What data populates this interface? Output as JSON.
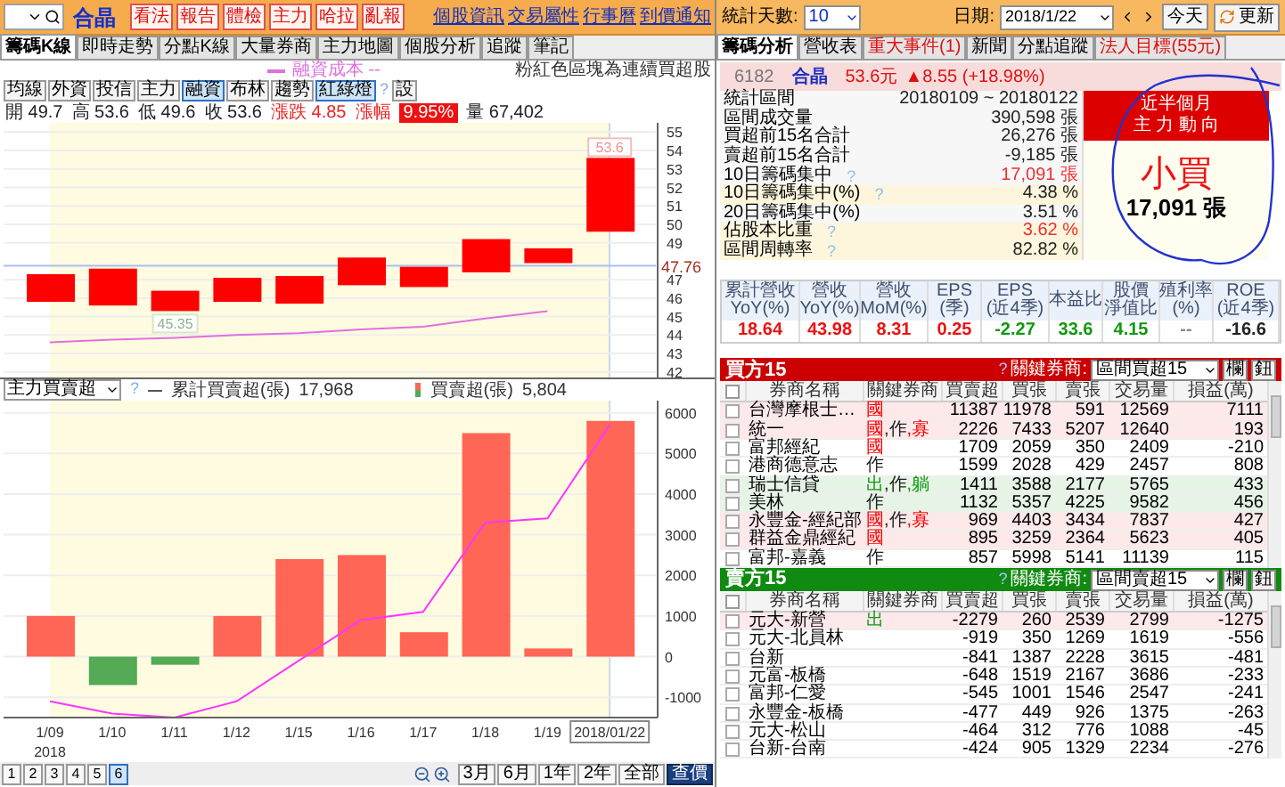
{
  "toolbar": {
    "stock_name": "合晶",
    "buttons": [
      "看法",
      "報告",
      "體檢",
      "主力",
      "哈拉",
      "亂報"
    ],
    "links": [
      "個股資訊",
      "交易屬性",
      "行事曆",
      "到價通知"
    ]
  },
  "right_toolbar": {
    "days_label": "統計天數:",
    "days_value": "10",
    "date_label": "日期:",
    "date_value": "2018/1/22",
    "today_button": "今天",
    "refresh_button": "更新"
  },
  "left_tabs": [
    {
      "label": "籌碼K線",
      "selected": true
    },
    {
      "label": "即時走勢",
      "selected": false
    },
    {
      "label": "分點K線",
      "selected": false
    },
    {
      "label": "大量券商",
      "selected": false
    },
    {
      "label": "主力地圖",
      "selected": false
    },
    {
      "label": "個股分析",
      "selected": false
    },
    {
      "label": "追蹤",
      "selected": false
    },
    {
      "label": "筆記",
      "selected": false
    }
  ],
  "left_note": "粉紅色區塊為連續買超股",
  "right_tabs": [
    {
      "label": "籌碼分析",
      "selected": true,
      "alert": false
    },
    {
      "label": "營收表",
      "selected": false,
      "alert": false
    },
    {
      "label": "重大事件(1)",
      "selected": false,
      "alert": true
    },
    {
      "label": "新聞",
      "selected": false,
      "alert": false
    },
    {
      "label": "分點追蹤",
      "selected": false,
      "alert": false
    },
    {
      "label": "法人目標(55元)",
      "selected": false,
      "alert": true
    }
  ],
  "price_chart": {
    "legend": "融資成本 --",
    "indicators": [
      {
        "label": "均線",
        "selected": false
      },
      {
        "label": "外資",
        "selected": false
      },
      {
        "label": "投信",
        "selected": false
      },
      {
        "label": "主力",
        "selected": false
      },
      {
        "label": "融資",
        "selected": true
      },
      {
        "label": "布林",
        "selected": false
      },
      {
        "label": "趨勢",
        "selected": false
      },
      {
        "label": "紅綠燈",
        "selected": true
      }
    ],
    "help": "?",
    "settings_button": "設",
    "quote": [
      {
        "text": "開 49.7",
        "kind": "plain"
      },
      {
        "text": "高 53.6",
        "kind": "plain"
      },
      {
        "text": "低 49.6",
        "kind": "plain"
      },
      {
        "text": "收 53.6",
        "kind": "plain"
      },
      {
        "text": "漲跌 4.85",
        "kind": "up"
      },
      {
        "text": "漲幅",
        "kind": "up"
      },
      {
        "text": "9.95%",
        "kind": "boxed"
      },
      {
        "text": "量 67,402",
        "kind": "plain"
      }
    ],
    "high_label": "53.6",
    "low_label": "45.35",
    "ref_label": "47.76",
    "y_axis_labels": [
      "55",
      "54",
      "53",
      "52",
      "51",
      "50",
      "49",
      "47",
      "46",
      "45",
      "44",
      "43",
      "42"
    ]
  },
  "flow_chart": {
    "indicator_select": "主力買賣超",
    "help": "?",
    "legend_line_value": "17,968",
    "legend_bar_value": "5,804",
    "year_label": "2018",
    "chart_data": {
      "type": "bar",
      "stacked": true,
      "grid": true,
      "bands": [
        {
          "axis": "x",
          "from": "1/09",
          "to": "2018/01/22",
          "color": "#fffbe0"
        }
      ],
      "ref_lines": [
        {
          "axis": "x",
          "value": "2018/01/22",
          "color": "#c8d8f0"
        }
      ],
      "categories": [
        "1/09",
        "1/10",
        "1/11",
        "1/12",
        "1/15",
        "1/16",
        "1/17",
        "1/18",
        "1/19",
        "2018/01/22"
      ],
      "ylim": [
        -1500,
        6300
      ],
      "yticks": [
        -1000,
        0,
        1000,
        2000,
        3000,
        4000,
        5000,
        6000
      ],
      "series": [
        {
          "name": "買賣超(張)",
          "color": "#ff6655",
          "values": [
            1000,
            null,
            null,
            1000,
            2400,
            2500,
            600,
            5500,
            200,
            5800
          ]
        },
        {
          "color": "#55aa55",
          "values": [
            null,
            -700,
            -200,
            null,
            null,
            null,
            null,
            null,
            null,
            null
          ]
        },
        {
          "name": "累計買賣超(張)",
          "type": "line",
          "color": "#ff33ff",
          "values": [
            -1100,
            -1400,
            -1500,
            -1100,
            -100,
            900,
            1100,
            3300,
            3400,
            5700
          ]
        }
      ]
    }
  },
  "bottom_nav": {
    "pages": [
      {
        "label": "1",
        "selected": false
      },
      {
        "label": "2",
        "selected": false
      },
      {
        "label": "3",
        "selected": false
      },
      {
        "label": "4",
        "selected": false
      },
      {
        "label": "5",
        "selected": false
      },
      {
        "label": "6",
        "selected": true
      }
    ],
    "ranges": [
      {
        "label": "3月",
        "selected": false
      },
      {
        "label": "6月",
        "selected": false
      },
      {
        "label": "1年",
        "selected": false
      },
      {
        "label": "2年",
        "selected": false
      },
      {
        "label": "全部",
        "selected": false
      },
      {
        "label": "查價",
        "selected": true
      }
    ]
  },
  "stock_header": {
    "code": "6182",
    "name": "合晶",
    "price": "53.6元",
    "change": "▲8.55 (+18.98%)"
  },
  "stats": [
    {
      "label": "統計區間",
      "value": "20180109 ~ 20180122",
      "red": false,
      "shaded": false
    },
    {
      "label": "區間成交量",
      "value": "390,598 張",
      "red": false,
      "shaded": false
    },
    {
      "label": "買超前15名合計",
      "value": "26,276 張",
      "red": false,
      "shaded": false
    },
    {
      "label": "賣超前15名合計",
      "value": "-9,185 張",
      "red": false,
      "shaded": false
    },
    {
      "label": "10日籌碼集中",
      "help": "?",
      "value": "17,091 張",
      "red": true,
      "shaded": false
    },
    {
      "label": "10日籌碼集中(%)",
      "help": "?",
      "value": "4.38 %",
      "red": false,
      "shaded": true
    },
    {
      "label": "20日籌碼集中(%)",
      "value": "3.51 %",
      "red": false,
      "shaded": false
    },
    {
      "label": "佔股本比重",
      "help": "?",
      "value": "3.62 %",
      "red": true,
      "shaded": true
    },
    {
      "label": "區間周轉率",
      "help": "?",
      "value": "82.82 %",
      "red": false,
      "shaded": true
    }
  ],
  "trend_box": {
    "title": "近半個月",
    "subtitle": "主 力 動 向",
    "verdict": "小買",
    "amount": "17,091 張"
  },
  "fundamentals": [
    {
      "label": "累計營收",
      "sub": "YoY(%)",
      "value": "18.64",
      "color": "#ee1111"
    },
    {
      "label": "營收",
      "sub": "YoY(%)",
      "value": "43.98",
      "color": "#ee1111"
    },
    {
      "label": "營收",
      "sub": "MoM(%)",
      "value": "8.31",
      "color": "#ee1111"
    },
    {
      "label": "EPS",
      "sub": "(季)",
      "value": "0.25",
      "color": "#ee1111"
    },
    {
      "label": "EPS",
      "sub": "(近4季)",
      "value": "-2.27",
      "color": "#119911"
    },
    {
      "label": "本益比",
      "value": "33.6",
      "color": "#119911"
    },
    {
      "label": "股價",
      "sub": "淨值比",
      "value": "4.15",
      "color": "#119911"
    },
    {
      "label": "殖利率",
      "sub": "(%)",
      "value": "--",
      "color": "#888888"
    },
    {
      "label": "ROE",
      "sub": "(近4季)",
      "value": "-16.6",
      "color": "#222222"
    }
  ],
  "buy_table": {
    "title": "買方15",
    "help": "?",
    "filter_label": "關鍵券商:",
    "filter_value": "區間買超15",
    "buttons": [
      "欄",
      "鈕"
    ],
    "header_checked": false,
    "columns": [
      "券商名稱",
      "關鍵券商",
      "買賣超",
      "買張",
      "賣張",
      "交易量",
      "損益(萬)"
    ],
    "rows": [
      {
        "checked": false,
        "color": "#fde8ea",
        "tags": [
          {
            "color": "#ff0000"
          }
        ],
        "cells": [
          "台灣摩根士…",
          "國",
          "11387",
          "11978",
          "591",
          "12569",
          "7111"
        ]
      },
      {
        "checked": false,
        "color": "#fde8ea",
        "tags": [
          {
            "color": "#ff0000"
          },
          {
            "color": "#222222"
          },
          {
            "color": "#ff0000"
          }
        ],
        "cells": [
          "統一",
          "國,作,寡",
          "2226",
          "7433",
          "5207",
          "12640",
          "193"
        ]
      },
      {
        "checked": false,
        "color": "#ffffff",
        "tags": [
          {
            "color": "#ff0000"
          }
        ],
        "cells": [
          "富邦經紀",
          "國",
          "1709",
          "2059",
          "350",
          "2409",
          "-210"
        ]
      },
      {
        "checked": false,
        "color": "#ffffff",
        "tags": [
          {
            "color": "#222222"
          }
        ],
        "cells": [
          "港商德意志",
          "作",
          "1599",
          "2028",
          "429",
          "2457",
          "808"
        ]
      },
      {
        "checked": false,
        "color": "#e6f4e6",
        "tags": [
          {
            "color": "#119911"
          },
          {
            "color": "#222222"
          },
          {
            "color": "#119911"
          }
        ],
        "cells": [
          "瑞士信貸",
          "出,作,躺",
          "1411",
          "3588",
          "2177",
          "5765",
          "433"
        ]
      },
      {
        "checked": false,
        "color": "#e6f4e6",
        "tags": [
          {
            "color": "#222222"
          }
        ],
        "cells": [
          "美林",
          "作",
          "1132",
          "5357",
          "4225",
          "9582",
          "456"
        ]
      },
      {
        "checked": false,
        "color": "#fde8ea",
        "tags": [
          {
            "color": "#ff0000"
          },
          {
            "color": "#222222"
          },
          {
            "color": "#ff0000"
          }
        ],
        "cells": [
          "永豐金-經紀部",
          "國,作,寡",
          "969",
          "4403",
          "3434",
          "7837",
          "427"
        ]
      },
      {
        "checked": false,
        "color": "#fde8ea",
        "tags": [
          {
            "color": "#ff0000"
          }
        ],
        "cells": [
          "群益金鼎經紀",
          "國",
          "895",
          "3259",
          "2364",
          "5623",
          "405"
        ]
      },
      {
        "checked": false,
        "color": "#ffffff",
        "tags": [
          {
            "color": "#222222"
          }
        ],
        "cells": [
          "富邦-嘉義",
          "作",
          "857",
          "5998",
          "5141",
          "11139",
          "115"
        ]
      }
    ]
  },
  "sell_table": {
    "title": "賣方15",
    "help": "?",
    "filter_label": "關鍵券商:",
    "filter_value": "區間賣超15",
    "buttons": [
      "欄",
      "鈕"
    ],
    "header_checked": false,
    "columns": [
      "券商名稱",
      "關鍵券商",
      "買賣超",
      "買張",
      "賣張",
      "交易量",
      "損益(萬)"
    ],
    "rows": [
      {
        "checked": false,
        "color": "#fde8ea",
        "tags": [
          {
            "color": "#119911"
          }
        ],
        "cells": [
          "元大-新營",
          "出",
          "-2279",
          "260",
          "2539",
          "2799",
          "-1275"
        ]
      },
      {
        "checked": false,
        "color": "#ffffff",
        "cells": [
          "元大-北員林",
          "",
          "-919",
          "350",
          "1269",
          "1619",
          "-556"
        ]
      },
      {
        "checked": false,
        "color": "#ffffff",
        "cells": [
          "台新",
          "",
          "-841",
          "1387",
          "2228",
          "3615",
          "-481"
        ]
      },
      {
        "checked": false,
        "color": "#ffffff",
        "cells": [
          "元富-板橋",
          "",
          "-648",
          "1519",
          "2167",
          "3686",
          "-233"
        ]
      },
      {
        "checked": false,
        "color": "#ffffff",
        "cells": [
          "富邦-仁愛",
          "",
          "-545",
          "1001",
          "1546",
          "2547",
          "-241"
        ]
      },
      {
        "checked": false,
        "color": "#ffffff",
        "cells": [
          "永豐金-板橋",
          "",
          "-477",
          "449",
          "926",
          "1375",
          "-263"
        ]
      },
      {
        "checked": false,
        "color": "#ffffff",
        "cells": [
          "元大-松山",
          "",
          "-464",
          "312",
          "776",
          "1088",
          "-45"
        ]
      },
      {
        "checked": false,
        "color": "#ffffff",
        "cells": [
          "台新-台南",
          "",
          "-424",
          "905",
          "1329",
          "2234",
          "-276"
        ]
      }
    ]
  }
}
